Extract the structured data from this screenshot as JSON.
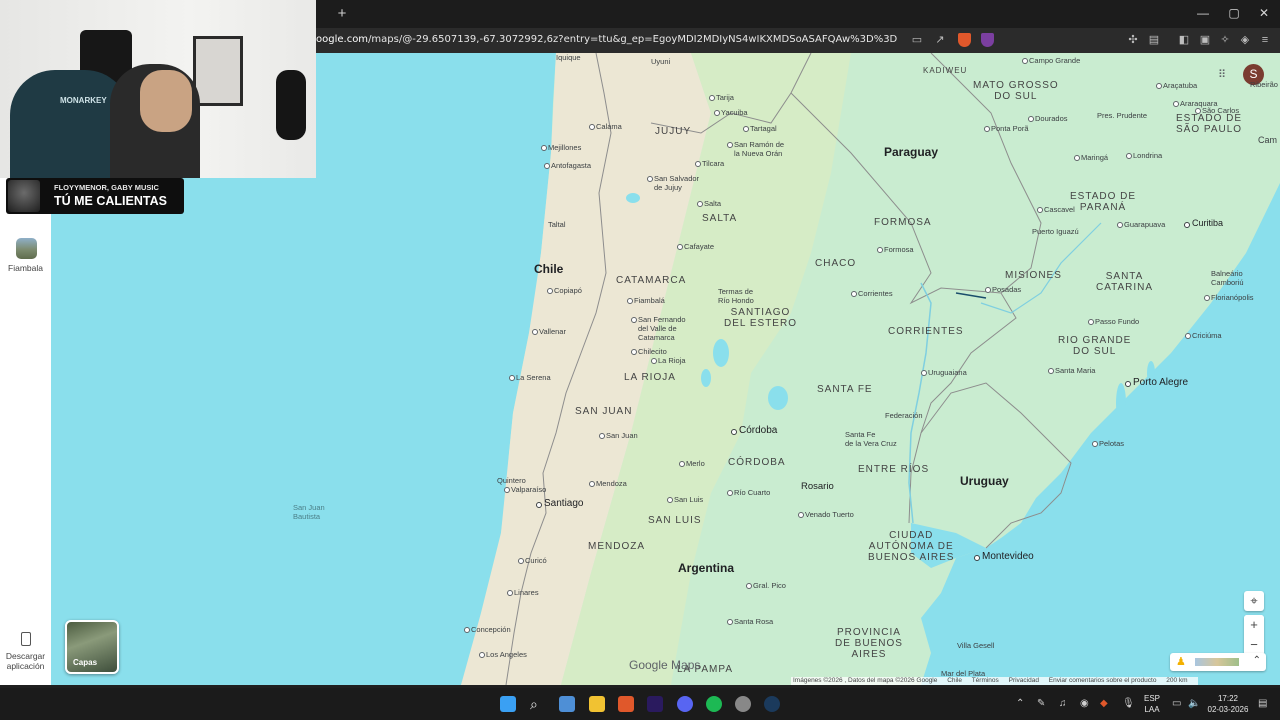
{
  "browser": {
    "new_tab": "+",
    "url_prefix": "oogle.com",
    "url_rest": "/maps/@-29.6507139,-67.3072992,6z?entry=ttu&g_ep=EgoyMDI2MDIyNS4wIKXMDSoASAFQAw%3D%3D",
    "window_controls": [
      "—",
      "▢",
      "✕"
    ]
  },
  "overlay": {
    "now_playing_artist": "FLOYYMENOR, GABY MUSIC",
    "now_playing_title": "TÚ ME CALIENTAS",
    "chair_text": "MONARKEY"
  },
  "rail": {
    "saved_place": "Fiambala",
    "download_app": "Descargar aplicación"
  },
  "map": {
    "avatar_letter": "S",
    "layers_label": "Capas",
    "logo": "Google Maps",
    "footer": [
      "Imágenes ©2026 , Datos del mapa ©2026 Google",
      "Chile",
      "Términos",
      "Privacidad",
      "Enviar comentarios sobre el producto",
      "200 km"
    ],
    "countries": {
      "chile": "Chile",
      "paraguay": "Paraguay",
      "uruguay": "Uruguay",
      "argentina": "Argentina"
    },
    "provinces": {
      "jujuy": "JUJUY",
      "salta": "SALTA",
      "formosa": "FORMOSA",
      "chaco": "CHACO",
      "misiones": "MISIONES",
      "catamarca": "CATAMARCA",
      "santiago": "SANTIAGO\nDEL ESTERO",
      "corrientes": "CORRIENTES",
      "larioja": "LA RIOJA",
      "santafe": "SANTA FE",
      "sanjuan": "SAN JUAN",
      "cordoba": "CÓRDOBA",
      "entrerios": "ENTRE RÍOS",
      "sanluis": "SAN LUIS",
      "mendoza": "MENDOZA",
      "caba": "CIUDAD\nAUTÓNOMA DE\nBUENOS AIRES",
      "bsas": "PROVINCIA\nDE BUENOS\nAIRES",
      "lapampa": "LA PAMPA",
      "matogrosso": "MATO GROSSO\nDO SUL",
      "saopaulo": "ESTADO DE\nSÃO PAULO",
      "parana": "ESTADO DE\nPARANÁ",
      "santacatarina": "SANTA\nCATARINA",
      "riogrande": "RIO GRANDE\nDO SUL",
      "kadiweu": "KADIWEU"
    },
    "cities": {
      "iquique": "Iquique",
      "uyuni": "Uyuni",
      "calama": "Calama",
      "mejillones": "Mejillones",
      "antofagasta": "Antofagasta",
      "tarija": "Tarija",
      "yacuiba": "Yacuiba",
      "tartagal": "Tartagal",
      "sanramon": "San Ramón de\nla Nueva Orán",
      "tilcara": "Tilcara",
      "ssjujuy": "San Salvador\nde Jujuy",
      "salta": "Salta",
      "taltal": "Taltal",
      "cafayate": "Cafayate",
      "formosa": "Formosa",
      "copiapo": "Copiapó",
      "fiambala": "Fiambalá",
      "termas": "Termas de\nRío Hondo",
      "corrientes": "Corrientes",
      "posadas": "Posadas",
      "sfvc": "San Fernando\ndel Valle de\nCatamarca",
      "vallenar": "Vallenar",
      "chilecito": "Chilecito",
      "larioja": "La Rioja",
      "laserena": "La Serena",
      "federacion": "Federación",
      "uruguaiana": "Uruguaiana",
      "santamaria": "Santa Maria",
      "sanjuan": "San Juan",
      "santafe": "Santa Fe\nde la Vera Cruz",
      "pelotas": "Pelotas",
      "merlo": "Merlo",
      "quintero": "Quintero",
      "valparaiso": "Valparaíso",
      "mendoza": "Mendoza",
      "sanluis": "San Luis",
      "riocuarto": "Río Cuarto",
      "sanjuanbautista": "San Juan\nBautista",
      "venado": "Venado Tuerto",
      "curico": "Curicó",
      "linares": "Linares",
      "grapico": "Gral. Pico",
      "concepcion": "Concepción",
      "santarosa": "Santa Rosa",
      "losangeles": "Los Angeles",
      "villagesell": "Villa Gesell",
      "mardelplata": "Mar del Plata",
      "campogrande": "Campo Grande",
      "aracatuba": "Araçatuba",
      "ribeirao": "Ribeirão P",
      "araraquara": "Araraquara",
      "pontapora": "Ponta Porã",
      "dourados": "Dourados",
      "presprudente": "Pres. Prudente",
      "saocarlos": "São Carlos",
      "maringa": "Maringá",
      "londrina": "Londrina",
      "cascavel": "Cascavel",
      "guarapuava": "Guarapuava",
      "puertoiguazu": "Puerto Iguazú",
      "curitiba": "Curitiba",
      "balneario": "Balneário\nCamboriú",
      "florianopolis": "Florianópolis",
      "passofundo": "Passo Fundo",
      "criciuma": "Criciúma",
      "camp": "Cam"
    },
    "big_cities": {
      "cordoba": "Córdoba",
      "rosario": "Rosario",
      "santiago": "Santiago",
      "montevideo": "Montevideo",
      "portoalegre": "Porto Alegre"
    }
  },
  "taskbar": {
    "lang": "ESP\nLAA",
    "time": "17:22",
    "date": "02-03-2026"
  }
}
